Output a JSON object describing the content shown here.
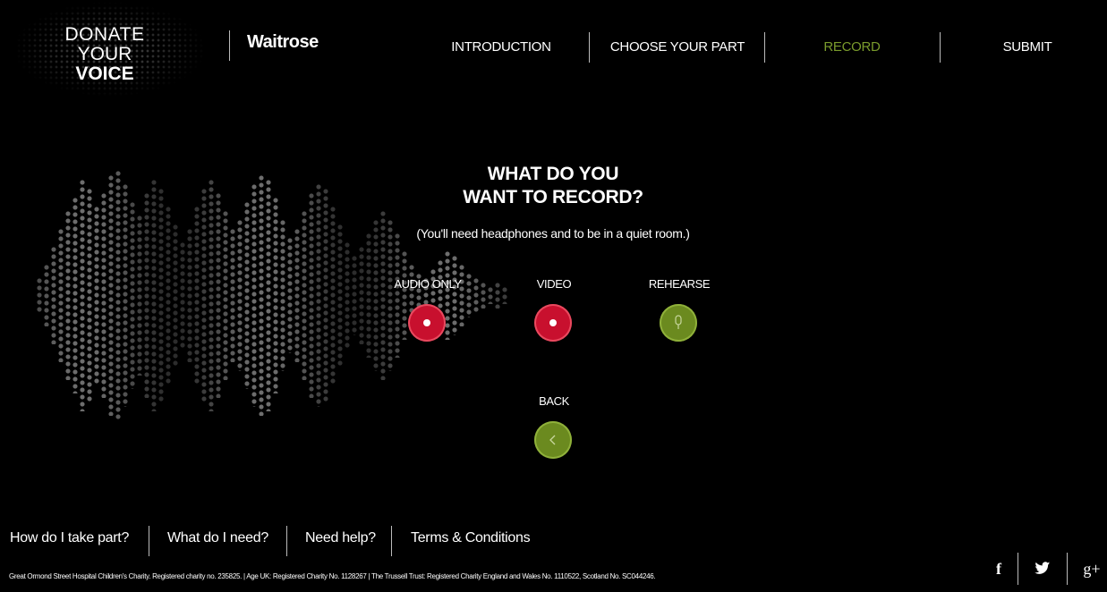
{
  "header": {
    "logo_line1": "DONATE",
    "logo_line2_a": "YOUR",
    "logo_line2_b": "VOICE",
    "brand": "Waitrose",
    "nav": [
      {
        "label": "INTRODUCTION"
      },
      {
        "label": "CHOOSE YOUR PART"
      },
      {
        "label": "RECORD",
        "active": true
      },
      {
        "label": "SUBMIT"
      }
    ]
  },
  "main": {
    "title_line1": "WHAT DO YOU",
    "title_line2": "WANT TO RECORD?",
    "subtitle": "(You'll need headphones and to be in a quiet room.)",
    "options": {
      "audio_label": "AUDIO ONLY",
      "video_label": "VIDEO",
      "rehearse_label": "REHEARSE",
      "back_label": "BACK"
    }
  },
  "footer": {
    "links": [
      "How do I take part?",
      "What do I need?",
      "Need help?",
      "Terms & Conditions"
    ],
    "legal": "Great Ormond Street Hospital Children's Charity. Registered charity no. 235825. | Age UK: Registered Charity No. 1128267 | The Trussell Trust: Registered Charity England and Wales No. 1110522, Scotland No. SC044246.",
    "social": {
      "facebook": "f",
      "twitter": "twitter-bird",
      "gplus": "g+"
    }
  },
  "colors": {
    "accent_green": "#7a9b2c",
    "record_red": "#c8102e",
    "button_green": "#6b8a1f"
  }
}
